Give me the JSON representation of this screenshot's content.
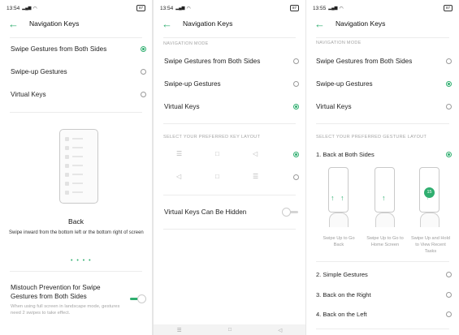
{
  "accent": "#2fae6f",
  "panel1": {
    "time": "13:54",
    "battery": "87",
    "title": "Navigation Keys",
    "options": [
      {
        "label": "Swipe Gestures from Both Sides",
        "selected": true
      },
      {
        "label": "Swipe-up Gestures",
        "selected": false
      },
      {
        "label": "Virtual Keys",
        "selected": false
      }
    ],
    "preview_title": "Back",
    "preview_desc": "Swipe inward from the bottom left or the bottom right of screen",
    "pager_dots": "• • • •",
    "mistouch_title": "Mistouch Prevention for Swipe Gestures from Both Sides",
    "mistouch_desc": "When using full screen in landscape mode, gestures need 2 swipes to take effect.",
    "mistouch_on": true
  },
  "panel2": {
    "time": "13:54",
    "battery": "87",
    "title": "Navigation Keys",
    "section_mode": "NAVIGATION MODE",
    "options": [
      {
        "label": "Swipe Gestures from Both Sides",
        "selected": false
      },
      {
        "label": "Swipe-up Gestures",
        "selected": false
      },
      {
        "label": "Virtual Keys",
        "selected": true
      }
    ],
    "section_layout": "SELECT YOUR PREFERRED KEY LAYOUT",
    "layouts": [
      {
        "keys": [
          "menu-icon",
          "home-square-icon",
          "back-triangle-icon"
        ],
        "glyphs": [
          "☰",
          "□",
          "◁"
        ],
        "selected": true
      },
      {
        "keys": [
          "back-triangle-icon",
          "home-square-icon",
          "menu-icon"
        ],
        "glyphs": [
          "◁",
          "□",
          "☰"
        ],
        "selected": false
      }
    ],
    "hidden_label": "Virtual Keys Can Be Hidden",
    "hidden_on": false,
    "navbar_glyphs": [
      "☰",
      "□",
      "◁"
    ]
  },
  "panel3": {
    "time": "13:55",
    "battery": "87",
    "title": "Navigation Keys",
    "section_mode": "NAVIGATION MODE",
    "options": [
      {
        "label": "Swipe Gestures from Both Sides",
        "selected": false
      },
      {
        "label": "Swipe-up Gestures",
        "selected": true
      },
      {
        "label": "Virtual Keys",
        "selected": false
      }
    ],
    "section_layout": "SELECT YOUR PREFERRED GESTURE LAYOUT",
    "layouts": [
      {
        "label": "1. Back at Both Sides",
        "selected": true
      },
      {
        "label": "2. Simple Gestures",
        "selected": false
      },
      {
        "label": "3. Back on the Right",
        "selected": false
      },
      {
        "label": "4. Back on the Left",
        "selected": false
      }
    ],
    "captions": [
      "Swipe Up to Go Back",
      "Swipe Up to Go to Home Screen",
      "Swipe Up and Hold to View Recent Tasks"
    ],
    "timer_badge": "15"
  }
}
